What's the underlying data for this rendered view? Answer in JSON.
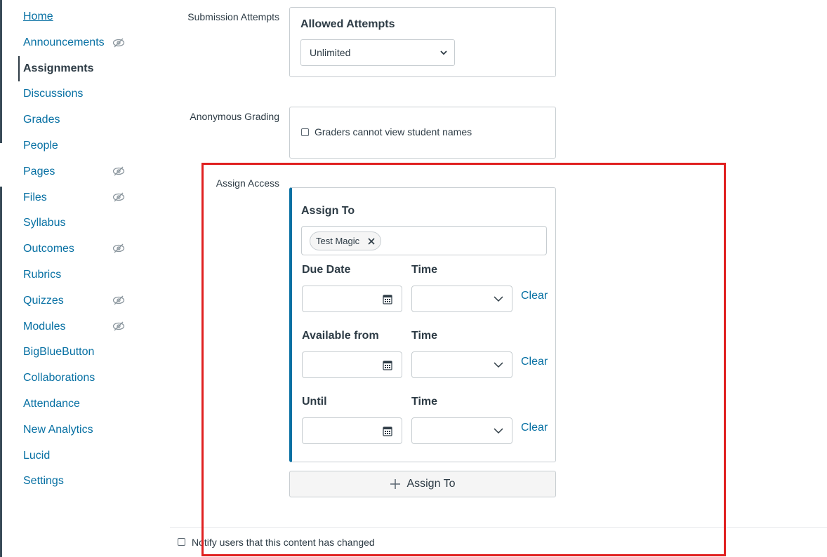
{
  "nav": {
    "items": [
      {
        "label": "Home"
      },
      {
        "label": "Announcements"
      },
      {
        "label": "Assignments"
      },
      {
        "label": "Discussions"
      },
      {
        "label": "Grades"
      },
      {
        "label": "People"
      },
      {
        "label": "Pages"
      },
      {
        "label": "Files"
      },
      {
        "label": "Syllabus"
      },
      {
        "label": "Outcomes"
      },
      {
        "label": "Rubrics"
      },
      {
        "label": "Quizzes"
      },
      {
        "label": "Modules"
      },
      {
        "label": "BigBlueButton"
      },
      {
        "label": "Collaborations"
      },
      {
        "label": "Attendance"
      },
      {
        "label": "New Analytics"
      },
      {
        "label": "Lucid"
      },
      {
        "label": "Settings"
      }
    ],
    "hidden_icon": "eye-slash-icon"
  },
  "submission": {
    "label": "Submission Attempts",
    "heading": "Allowed Attempts",
    "selected": "Unlimited"
  },
  "anonymous": {
    "label": "Anonymous Grading",
    "checkbox_label": "Graders cannot view student names"
  },
  "assign": {
    "label": "Assign Access",
    "heading": "Assign To",
    "assignee": "Test Magic",
    "due_label": "Due Date",
    "available_label": "Available from",
    "until_label": "Until",
    "time_label": "Time",
    "clear_label": "Clear",
    "add_button": "Assign To"
  },
  "notify": {
    "label": "Notify users that this content has changed"
  },
  "colors": {
    "link": "#0770a3",
    "accent": "#0770a3",
    "highlight": "#e02020"
  }
}
